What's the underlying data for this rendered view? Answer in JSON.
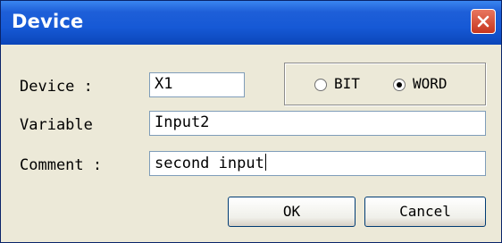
{
  "window": {
    "title": "Device"
  },
  "form": {
    "device_label": "Device :",
    "device_value": "X1",
    "variable_label": "Variable",
    "variable_value": "Input2",
    "comment_label": "Comment :",
    "comment_value": "second input"
  },
  "type_options": [
    {
      "label": "BIT",
      "selected": false
    },
    {
      "label": "WORD",
      "selected": true
    }
  ],
  "buttons": {
    "ok_label": "OK",
    "cancel_label": "Cancel"
  },
  "colors": {
    "titlebar": "#1659D6",
    "close_button": "#C7361F",
    "dialog_bg": "#ECE9D8",
    "field_border": "#7F9DB9"
  },
  "icons": {
    "close": "close-icon"
  }
}
